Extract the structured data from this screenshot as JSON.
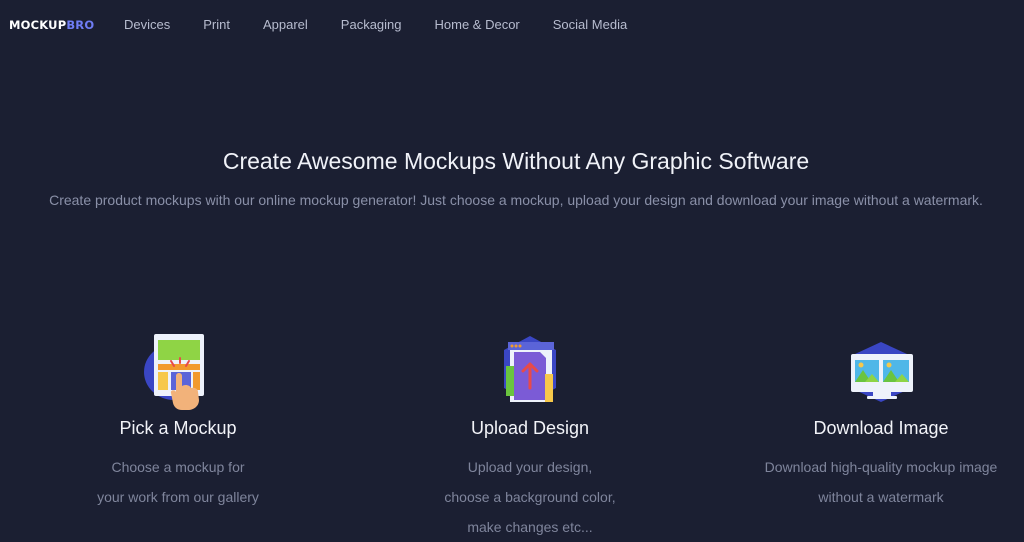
{
  "brand": {
    "logo_main": "MOCKUP",
    "logo_accent": "BRO",
    "accent_color": "#6f7df5"
  },
  "nav": {
    "items": [
      {
        "label": "Devices"
      },
      {
        "label": "Print"
      },
      {
        "label": "Apparel"
      },
      {
        "label": "Packaging"
      },
      {
        "label": "Home & Decor"
      },
      {
        "label": "Social Media"
      }
    ]
  },
  "hero": {
    "title": "Create Awesome Mockups Without Any Graphic Software",
    "subtitle": "Create product mockups with our online mockup generator! Just choose a mockup, upload your design and download your image without a watermark."
  },
  "features": [
    {
      "icon": "pick-mockup-icon",
      "title": "Pick a Mockup",
      "desc": [
        "Choose a mockup for",
        "your work from our gallery"
      ]
    },
    {
      "icon": "upload-design-icon",
      "title": "Upload Design",
      "desc": [
        "Upload your design,",
        "choose a background color,",
        "make changes etc..."
      ]
    },
    {
      "icon": "download-image-icon",
      "title": "Download Image",
      "desc": [
        "Download high-quality mockup image",
        "without a watermark"
      ]
    }
  ],
  "colors": {
    "background": "#1b1f32",
    "icon_blob": "#3a46c4"
  }
}
